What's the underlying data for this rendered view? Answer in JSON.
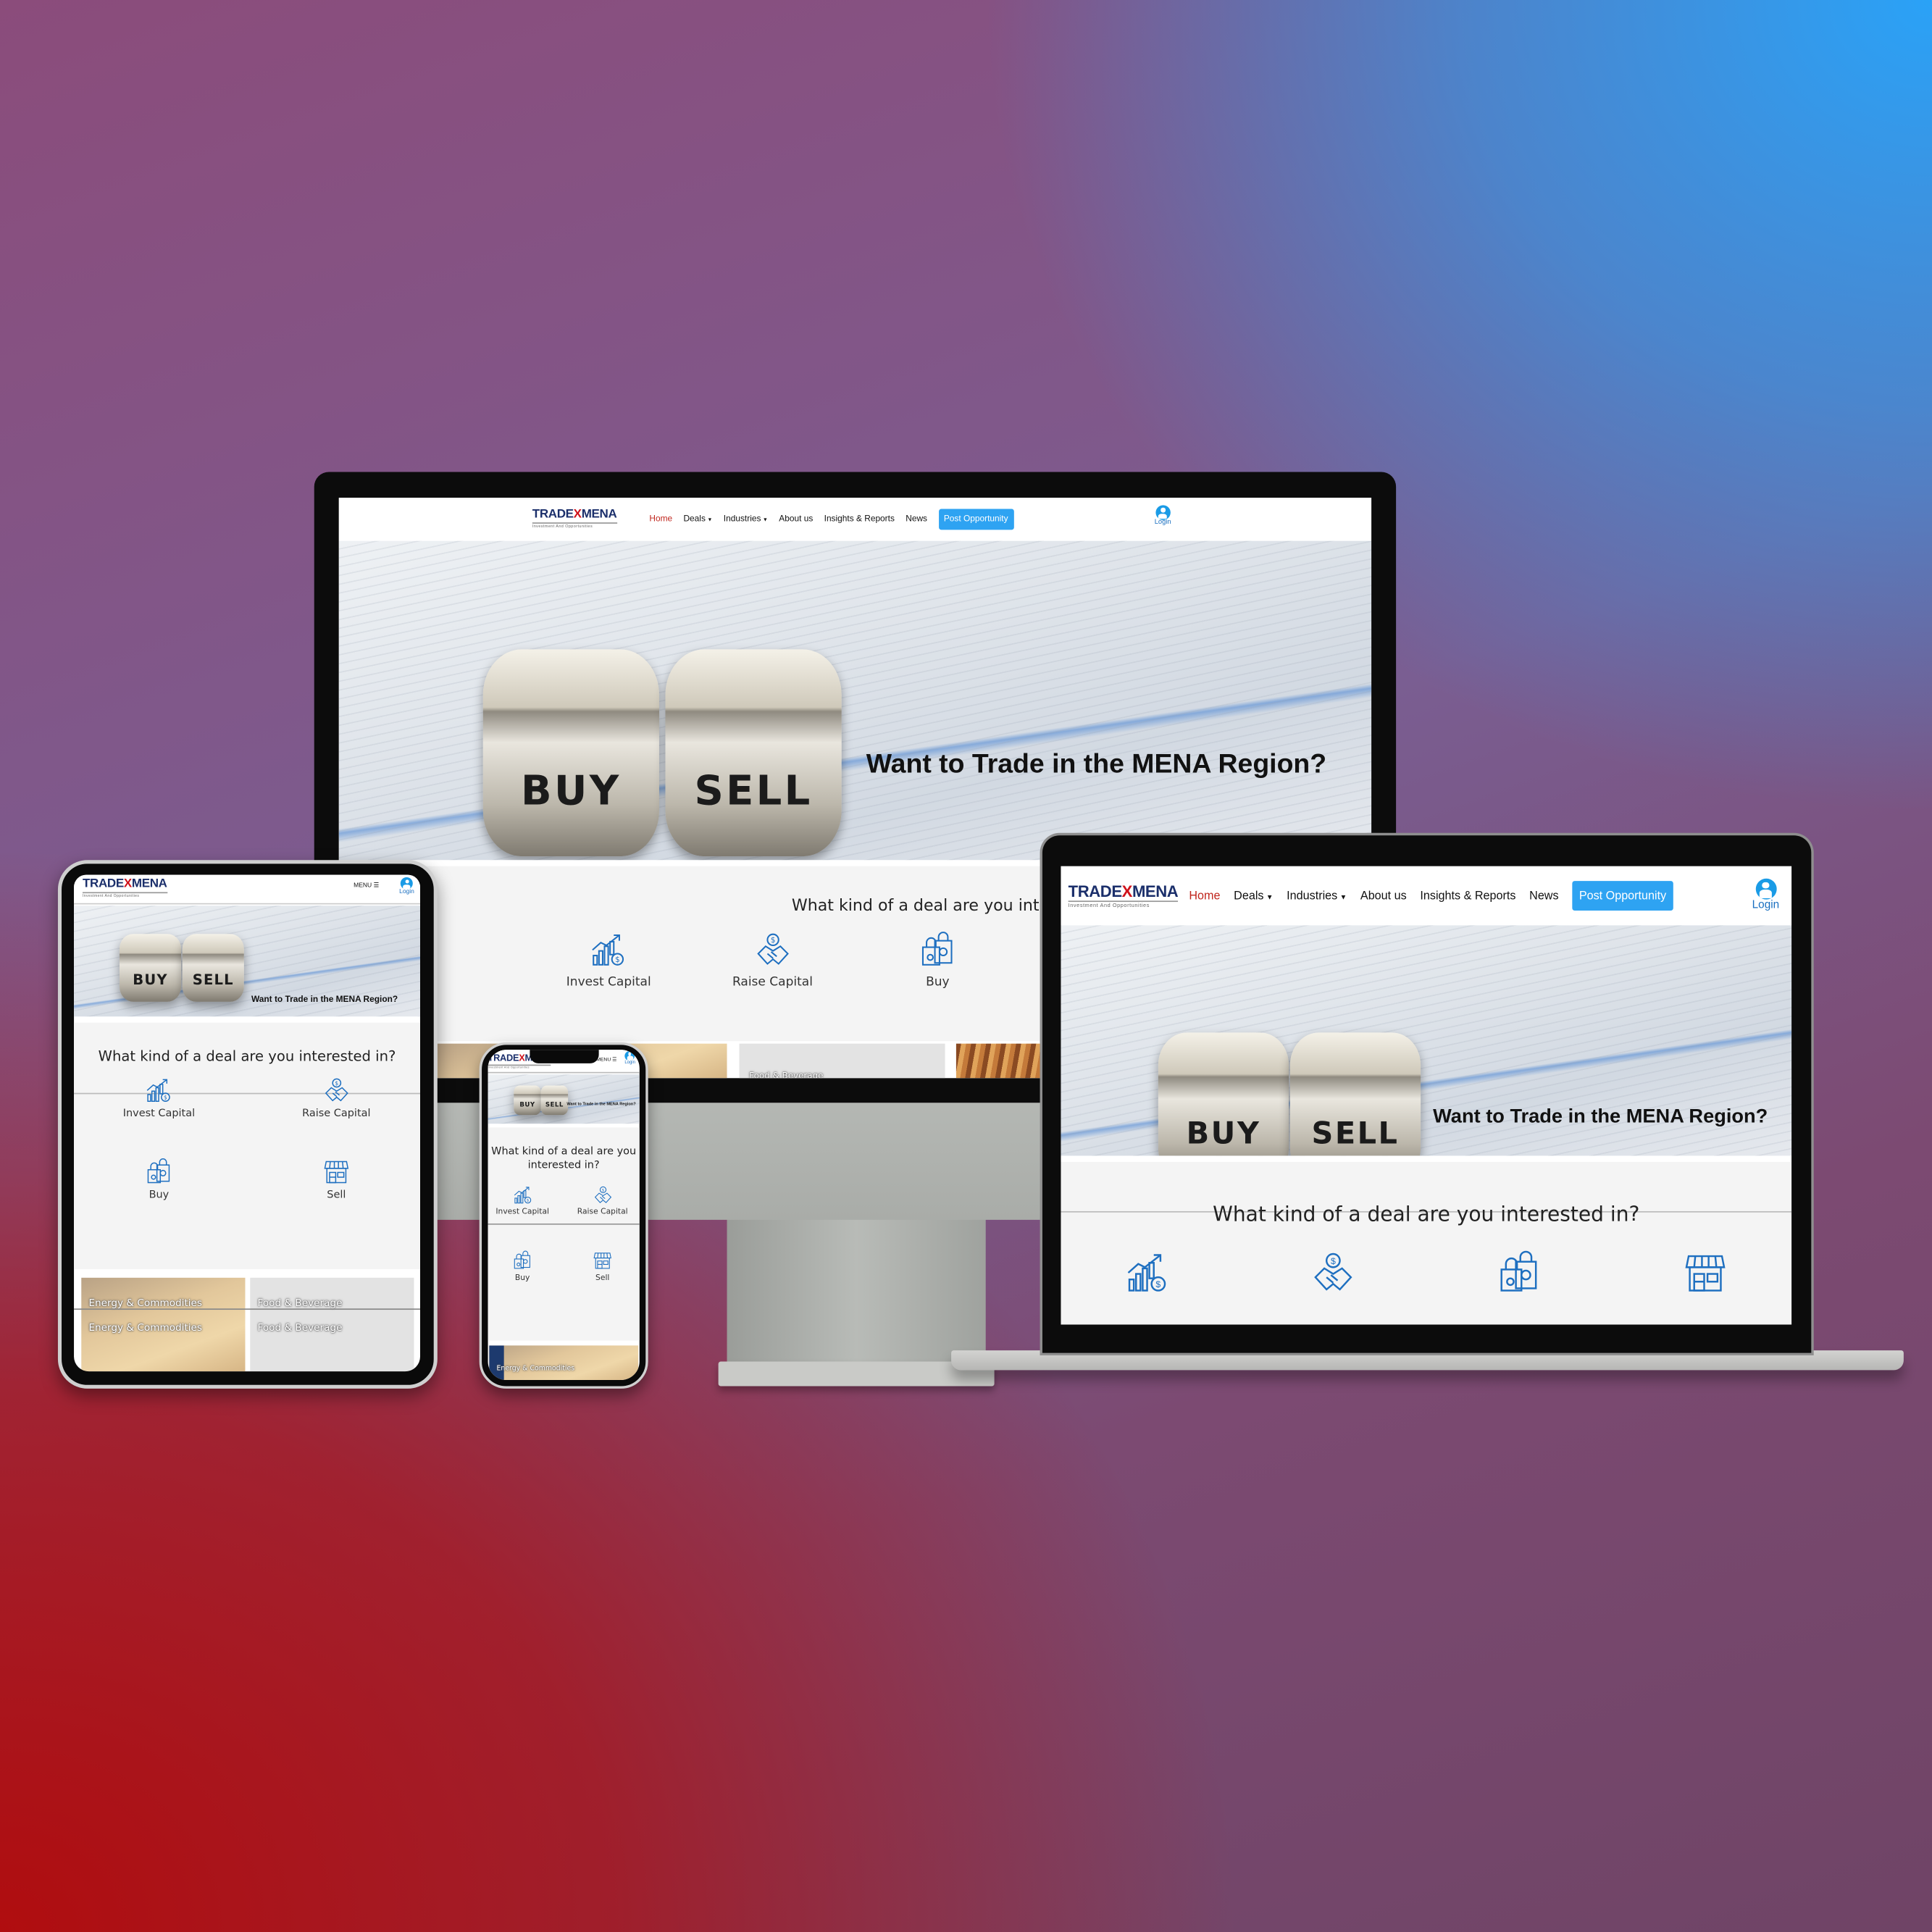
{
  "site": {
    "brand": {
      "left": "TRADE",
      "x": "X",
      "right": "MENA",
      "tagline": "Investment And Opportunities"
    },
    "nav": [
      {
        "label": "Home",
        "active": true
      },
      {
        "label": "Deals",
        "dropdown": true
      },
      {
        "label": "Industries",
        "dropdown": true
      },
      {
        "label": "About us"
      },
      {
        "label": "Insights & Reports"
      },
      {
        "label": "News"
      }
    ],
    "post_button": "Post Opportunity",
    "login": "Login",
    "menu": "MENU",
    "hero": {
      "title": "Want to Trade in the MENA Region?",
      "dice": [
        "BUY",
        "SELL"
      ]
    },
    "deal_heading": "What kind of a deal are you interested in?",
    "deal_heading_lines": [
      "What kind of a deal are you",
      "interested in?"
    ],
    "deal_options": [
      {
        "label": "Invest Capital",
        "icon": "invest-chart-icon"
      },
      {
        "label": "Raise Capital",
        "icon": "handshake-coin-icon"
      },
      {
        "label": "Buy",
        "icon": "shopping-bags-icon"
      },
      {
        "label": "Sell",
        "icon": "storefront-icon"
      }
    ],
    "categories": [
      "Energy & Commodities",
      "Food & Beverage"
    ]
  },
  "colors": {
    "accent": "#2ea3f2",
    "brand_navy": "#1b2f6b",
    "brand_red": "#d0121b",
    "icon_blue": "#1e6fc0",
    "nav_active": "#c0261d"
  }
}
